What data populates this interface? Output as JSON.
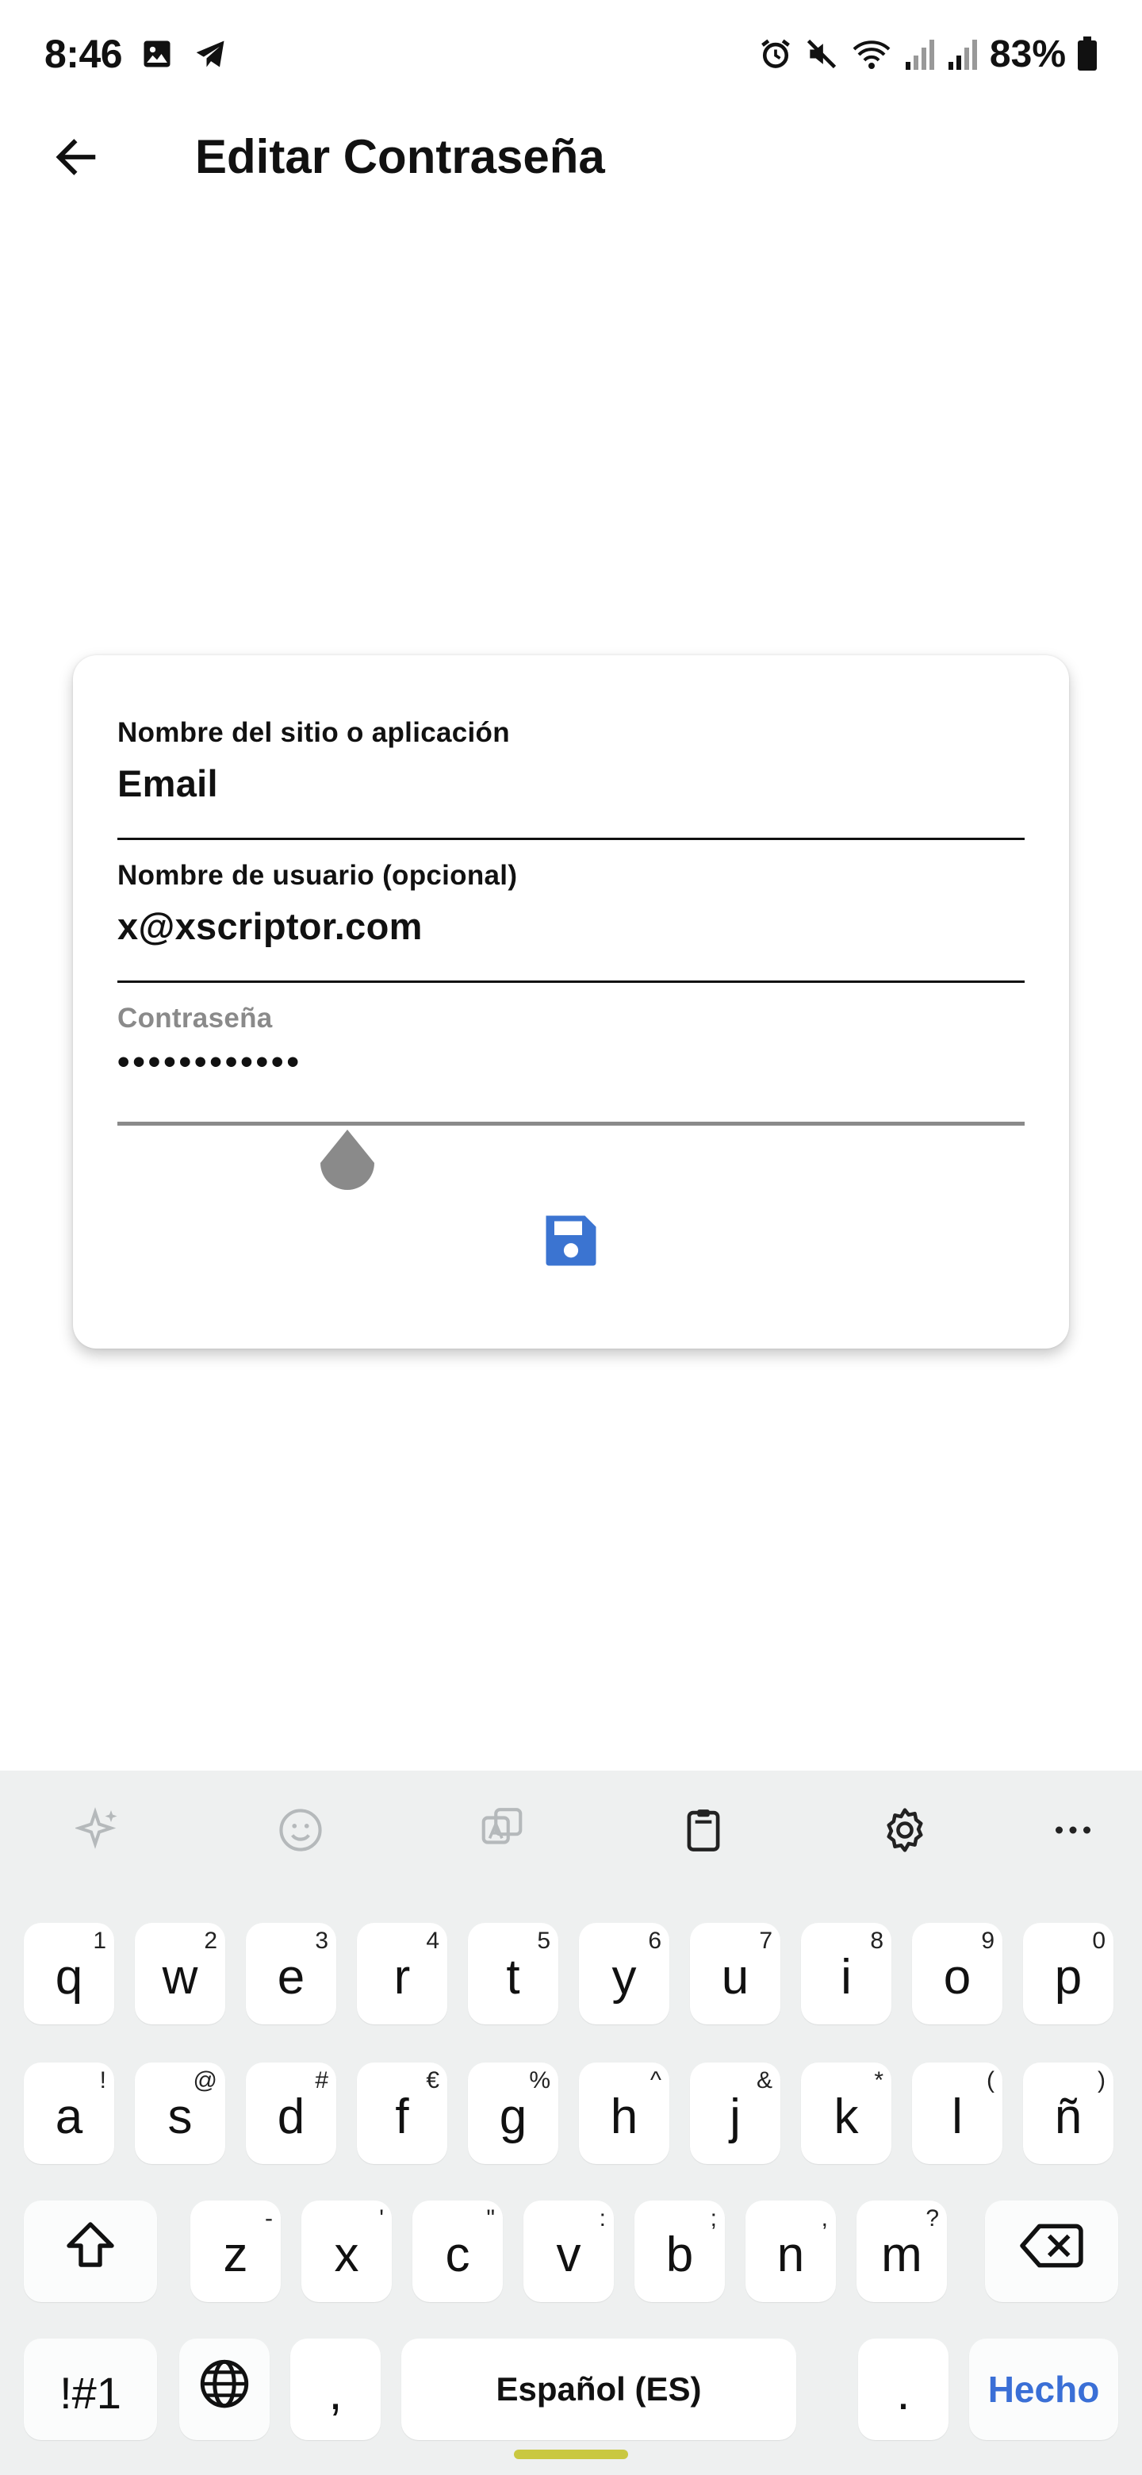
{
  "status_bar": {
    "time": "8:46",
    "battery": "83%",
    "left_icons": [
      "image-icon",
      "telegram-icon"
    ],
    "right_icons": [
      "alarm-icon",
      "mute-icon",
      "wifi-icon",
      "signal-icon",
      "signal-icon",
      "battery-icon"
    ]
  },
  "app_bar": {
    "title": "Editar Contraseña",
    "back_icon": "arrow-left-icon"
  },
  "form": {
    "site_label": "Nombre del sitio o aplicación",
    "site_value": "Email",
    "user_label": "Nombre de usuario (opcional)",
    "user_value": "x@xscriptor.com",
    "password_label": "Contraseña",
    "password_value": "••••••••••••",
    "save_icon": "floppy-disk-icon",
    "accent_color": "#3b74d1"
  },
  "keyboard": {
    "toolbar": [
      "sparkle-icon",
      "emoji-icon",
      "translate-icon",
      "clipboard-icon",
      "gear-icon",
      "more-icon"
    ],
    "row1": [
      {
        "k": "q",
        "s": "1"
      },
      {
        "k": "w",
        "s": "2"
      },
      {
        "k": "e",
        "s": "3"
      },
      {
        "k": "r",
        "s": "4"
      },
      {
        "k": "t",
        "s": "5"
      },
      {
        "k": "y",
        "s": "6"
      },
      {
        "k": "u",
        "s": "7"
      },
      {
        "k": "i",
        "s": "8"
      },
      {
        "k": "o",
        "s": "9"
      },
      {
        "k": "p",
        "s": "0"
      }
    ],
    "row2": [
      {
        "k": "a",
        "s": "!"
      },
      {
        "k": "s",
        "s": "@"
      },
      {
        "k": "d",
        "s": "#"
      },
      {
        "k": "f",
        "s": "€"
      },
      {
        "k": "g",
        "s": "%"
      },
      {
        "k": "h",
        "s": "^"
      },
      {
        "k": "j",
        "s": "&"
      },
      {
        "k": "k",
        "s": "*"
      },
      {
        "k": "l",
        "s": "("
      },
      {
        "k": "ñ",
        "s": ")"
      }
    ],
    "row3": [
      {
        "k": "z",
        "s": "-"
      },
      {
        "k": "x",
        "s": "'"
      },
      {
        "k": "c",
        "s": "\""
      },
      {
        "k": "v",
        "s": ":"
      },
      {
        "k": "b",
        "s": ";"
      },
      {
        "k": "n",
        "s": ","
      },
      {
        "k": "m",
        "s": "?"
      }
    ],
    "symbols_label": "!#1",
    "comma_label": ",",
    "space_label": "Español (ES)",
    "period_label": ".",
    "done_label": "Hecho",
    "done_color": "#3a6fd6"
  }
}
